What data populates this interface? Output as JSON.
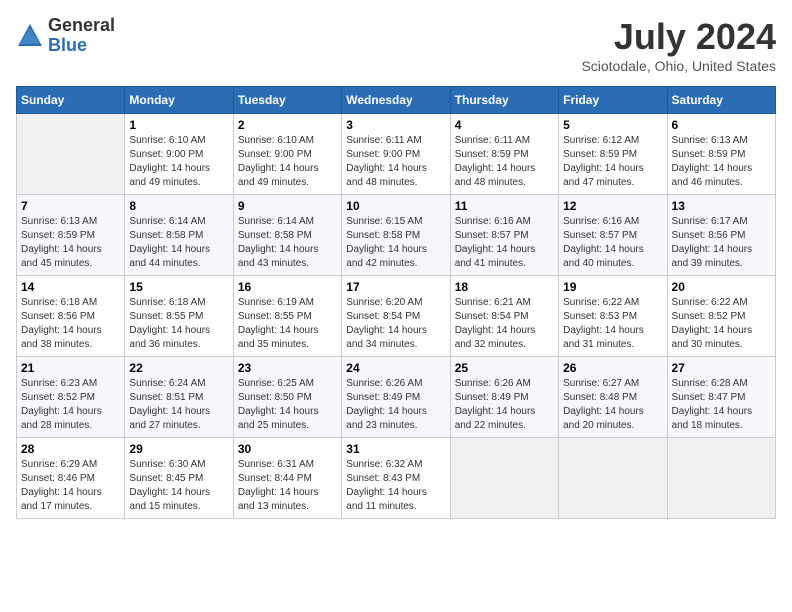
{
  "logo": {
    "text_general": "General",
    "text_blue": "Blue"
  },
  "title": "July 2024",
  "subtitle": "Sciotodale, Ohio, United States",
  "days_of_week": [
    "Sunday",
    "Monday",
    "Tuesday",
    "Wednesday",
    "Thursday",
    "Friday",
    "Saturday"
  ],
  "weeks": [
    [
      {
        "day": "",
        "info": ""
      },
      {
        "day": "1",
        "info": "Sunrise: 6:10 AM\nSunset: 9:00 PM\nDaylight: 14 hours\nand 49 minutes."
      },
      {
        "day": "2",
        "info": "Sunrise: 6:10 AM\nSunset: 9:00 PM\nDaylight: 14 hours\nand 49 minutes."
      },
      {
        "day": "3",
        "info": "Sunrise: 6:11 AM\nSunset: 9:00 PM\nDaylight: 14 hours\nand 48 minutes."
      },
      {
        "day": "4",
        "info": "Sunrise: 6:11 AM\nSunset: 8:59 PM\nDaylight: 14 hours\nand 48 minutes."
      },
      {
        "day": "5",
        "info": "Sunrise: 6:12 AM\nSunset: 8:59 PM\nDaylight: 14 hours\nand 47 minutes."
      },
      {
        "day": "6",
        "info": "Sunrise: 6:13 AM\nSunset: 8:59 PM\nDaylight: 14 hours\nand 46 minutes."
      }
    ],
    [
      {
        "day": "7",
        "info": "Sunrise: 6:13 AM\nSunset: 8:59 PM\nDaylight: 14 hours\nand 45 minutes."
      },
      {
        "day": "8",
        "info": "Sunrise: 6:14 AM\nSunset: 8:58 PM\nDaylight: 14 hours\nand 44 minutes."
      },
      {
        "day": "9",
        "info": "Sunrise: 6:14 AM\nSunset: 8:58 PM\nDaylight: 14 hours\nand 43 minutes."
      },
      {
        "day": "10",
        "info": "Sunrise: 6:15 AM\nSunset: 8:58 PM\nDaylight: 14 hours\nand 42 minutes."
      },
      {
        "day": "11",
        "info": "Sunrise: 6:16 AM\nSunset: 8:57 PM\nDaylight: 14 hours\nand 41 minutes."
      },
      {
        "day": "12",
        "info": "Sunrise: 6:16 AM\nSunset: 8:57 PM\nDaylight: 14 hours\nand 40 minutes."
      },
      {
        "day": "13",
        "info": "Sunrise: 6:17 AM\nSunset: 8:56 PM\nDaylight: 14 hours\nand 39 minutes."
      }
    ],
    [
      {
        "day": "14",
        "info": "Sunrise: 6:18 AM\nSunset: 8:56 PM\nDaylight: 14 hours\nand 38 minutes."
      },
      {
        "day": "15",
        "info": "Sunrise: 6:18 AM\nSunset: 8:55 PM\nDaylight: 14 hours\nand 36 minutes."
      },
      {
        "day": "16",
        "info": "Sunrise: 6:19 AM\nSunset: 8:55 PM\nDaylight: 14 hours\nand 35 minutes."
      },
      {
        "day": "17",
        "info": "Sunrise: 6:20 AM\nSunset: 8:54 PM\nDaylight: 14 hours\nand 34 minutes."
      },
      {
        "day": "18",
        "info": "Sunrise: 6:21 AM\nSunset: 8:54 PM\nDaylight: 14 hours\nand 32 minutes."
      },
      {
        "day": "19",
        "info": "Sunrise: 6:22 AM\nSunset: 8:53 PM\nDaylight: 14 hours\nand 31 minutes."
      },
      {
        "day": "20",
        "info": "Sunrise: 6:22 AM\nSunset: 8:52 PM\nDaylight: 14 hours\nand 30 minutes."
      }
    ],
    [
      {
        "day": "21",
        "info": "Sunrise: 6:23 AM\nSunset: 8:52 PM\nDaylight: 14 hours\nand 28 minutes."
      },
      {
        "day": "22",
        "info": "Sunrise: 6:24 AM\nSunset: 8:51 PM\nDaylight: 14 hours\nand 27 minutes."
      },
      {
        "day": "23",
        "info": "Sunrise: 6:25 AM\nSunset: 8:50 PM\nDaylight: 14 hours\nand 25 minutes."
      },
      {
        "day": "24",
        "info": "Sunrise: 6:26 AM\nSunset: 8:49 PM\nDaylight: 14 hours\nand 23 minutes."
      },
      {
        "day": "25",
        "info": "Sunrise: 6:26 AM\nSunset: 8:49 PM\nDaylight: 14 hours\nand 22 minutes."
      },
      {
        "day": "26",
        "info": "Sunrise: 6:27 AM\nSunset: 8:48 PM\nDaylight: 14 hours\nand 20 minutes."
      },
      {
        "day": "27",
        "info": "Sunrise: 6:28 AM\nSunset: 8:47 PM\nDaylight: 14 hours\nand 18 minutes."
      }
    ],
    [
      {
        "day": "28",
        "info": "Sunrise: 6:29 AM\nSunset: 8:46 PM\nDaylight: 14 hours\nand 17 minutes."
      },
      {
        "day": "29",
        "info": "Sunrise: 6:30 AM\nSunset: 8:45 PM\nDaylight: 14 hours\nand 15 minutes."
      },
      {
        "day": "30",
        "info": "Sunrise: 6:31 AM\nSunset: 8:44 PM\nDaylight: 14 hours\nand 13 minutes."
      },
      {
        "day": "31",
        "info": "Sunrise: 6:32 AM\nSunset: 8:43 PM\nDaylight: 14 hours\nand 11 minutes."
      },
      {
        "day": "",
        "info": ""
      },
      {
        "day": "",
        "info": ""
      },
      {
        "day": "",
        "info": ""
      }
    ]
  ]
}
